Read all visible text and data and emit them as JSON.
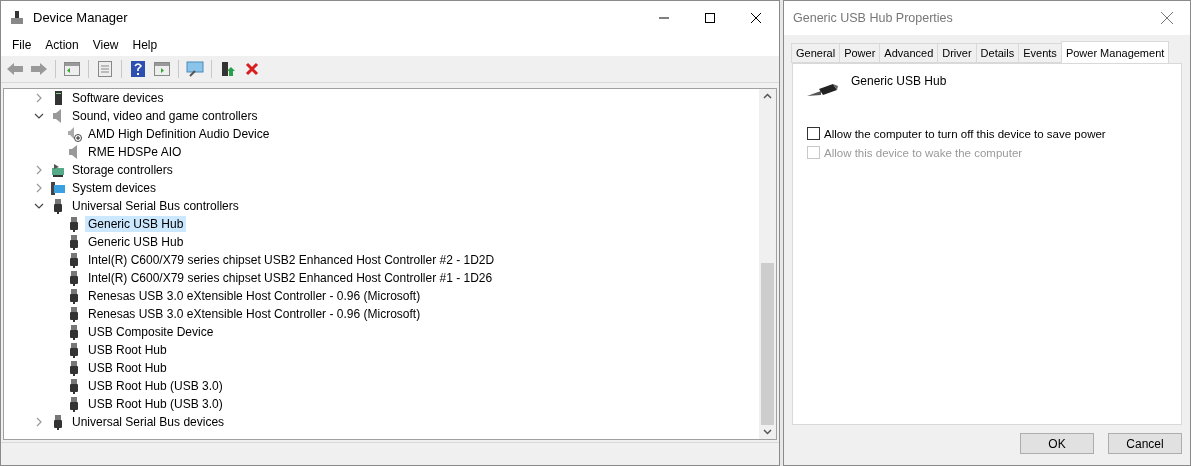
{
  "device_manager": {
    "title": "Device Manager",
    "menu": [
      "File",
      "Action",
      "View",
      "Help"
    ],
    "tree": [
      {
        "label": "Software devices",
        "kind": "software",
        "expanded": false,
        "selected": false
      },
      {
        "label": "Sound, video and game controllers",
        "kind": "sound",
        "expanded": true,
        "selected": false,
        "children": [
          {
            "label": "AMD High Definition Audio Device",
            "kind": "audio",
            "selected": false
          },
          {
            "label": "RME HDSPe AIO",
            "kind": "sound",
            "selected": false
          }
        ]
      },
      {
        "label": "Storage controllers",
        "kind": "storage",
        "expanded": false,
        "selected": false
      },
      {
        "label": "System devices",
        "kind": "system",
        "expanded": false,
        "selected": false
      },
      {
        "label": "Universal Serial Bus controllers",
        "kind": "usb",
        "expanded": true,
        "selected": false,
        "children": [
          {
            "label": "Generic USB Hub",
            "kind": "usb",
            "selected": true
          },
          {
            "label": "Generic USB Hub",
            "kind": "usb",
            "selected": false
          },
          {
            "label": "Intel(R) C600/X79 series chipset USB2 Enhanced Host Controller #2 - 1D2D",
            "kind": "usb",
            "selected": false
          },
          {
            "label": "Intel(R) C600/X79 series chipset USB2 Enhanced Host Controller #1 - 1D26",
            "kind": "usb",
            "selected": false
          },
          {
            "label": "Renesas USB 3.0 eXtensible Host Controller - 0.96 (Microsoft)",
            "kind": "usb",
            "selected": false
          },
          {
            "label": "Renesas USB 3.0 eXtensible Host Controller - 0.96 (Microsoft)",
            "kind": "usb",
            "selected": false
          },
          {
            "label": "USB Composite Device",
            "kind": "usb",
            "selected": false
          },
          {
            "label": "USB Root Hub",
            "kind": "usb",
            "selected": false
          },
          {
            "label": "USB Root Hub",
            "kind": "usb",
            "selected": false
          },
          {
            "label": "USB Root Hub (USB 3.0)",
            "kind": "usb",
            "selected": false
          },
          {
            "label": "USB Root Hub (USB 3.0)",
            "kind": "usb",
            "selected": false
          }
        ]
      },
      {
        "label": "Universal Serial Bus devices",
        "kind": "usb",
        "expanded": false,
        "selected": false
      }
    ]
  },
  "properties": {
    "title": "Generic USB Hub Properties",
    "tabs": [
      {
        "label": "General",
        "selected": false
      },
      {
        "label": "Power",
        "selected": false
      },
      {
        "label": "Advanced",
        "selected": false
      },
      {
        "label": "Driver",
        "selected": false
      },
      {
        "label": "Details",
        "selected": false
      },
      {
        "label": "Events",
        "selected": false
      },
      {
        "label": "Power Management",
        "selected": true
      }
    ],
    "device_name": "Generic USB Hub",
    "options": [
      {
        "label": "Allow the computer to turn off this device to save power",
        "checked": false,
        "disabled": false
      },
      {
        "label": "Allow this device to wake the computer",
        "checked": false,
        "disabled": true
      }
    ],
    "buttons": [
      "OK",
      "Cancel"
    ]
  }
}
